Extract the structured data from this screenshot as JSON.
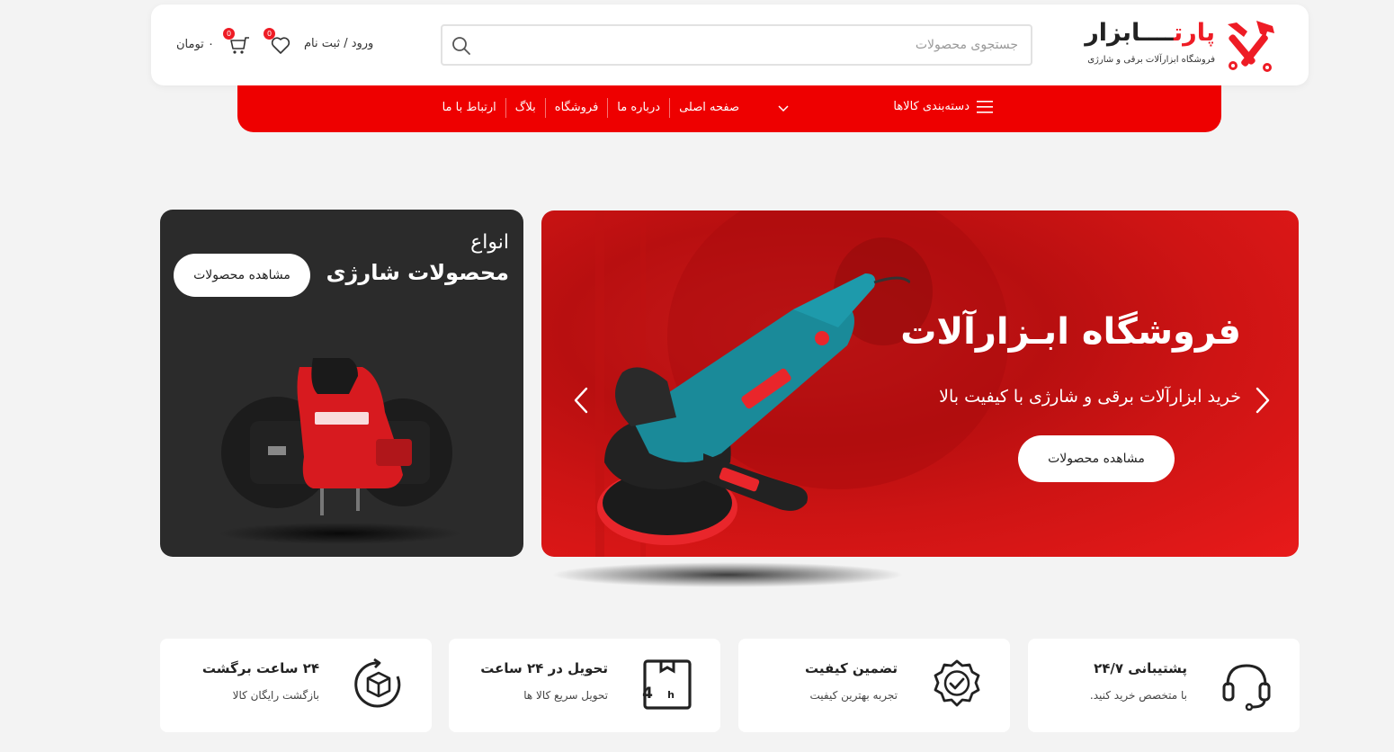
{
  "colors": {
    "accent": "#ee1c25",
    "nav_bg": "#ee0000",
    "page_bg": "#f3f3f3",
    "dark_banner": "#2b2b2b"
  },
  "header": {
    "logo": {
      "name_prefix": "پارت",
      "name_suffix": "ابزار",
      "tagline": "فروشگاه ابزارآلات برقی و شارژی"
    },
    "search": {
      "placeholder": "جستجوی محصولات",
      "value": "",
      "icon": "search-icon"
    },
    "account": {
      "label": "ورود / ثبت نام"
    },
    "wishlist": {
      "count": "0",
      "icon": "heart-icon"
    },
    "cart": {
      "count": "0",
      "total": "۰ تومان",
      "icon": "cart-icon"
    }
  },
  "nav": {
    "categories_label": "دسته‌بندی کالاها",
    "items": [
      {
        "label": "صفحه اصلی"
      },
      {
        "label": "درباره ما"
      },
      {
        "label": "فروشگاه"
      },
      {
        "label": "بلاگ"
      },
      {
        "label": "ارتباط با ما"
      }
    ]
  },
  "hero": {
    "title": "فروشگاه ابـزارآلات",
    "subtitle": "خرید ابزارآلات برقی و شارژی با کیفیت بالا",
    "button": "مشاهده محصولات"
  },
  "side_banner": {
    "pretitle": "انواع",
    "title": "محصولات شارژی",
    "button": "مشاهده محصولات"
  },
  "features": [
    {
      "title": "پشتیبانی ۲۴/۷",
      "subtitle": "با متخصص خرید کنید.",
      "icon": "headset-icon"
    },
    {
      "title": "تضمین کیفیت",
      "subtitle": "تجربه بهترین کیفیت",
      "icon": "quality-badge-icon"
    },
    {
      "title": "تحویل در ۲۴ ساعت",
      "subtitle": "تحویل سریع کالا ها",
      "icon": "24h-delivery-icon"
    },
    {
      "title": "۲۴ ساعت برگشت",
      "subtitle": "بازگشت رایگان کالا",
      "icon": "return-box-icon"
    }
  ]
}
